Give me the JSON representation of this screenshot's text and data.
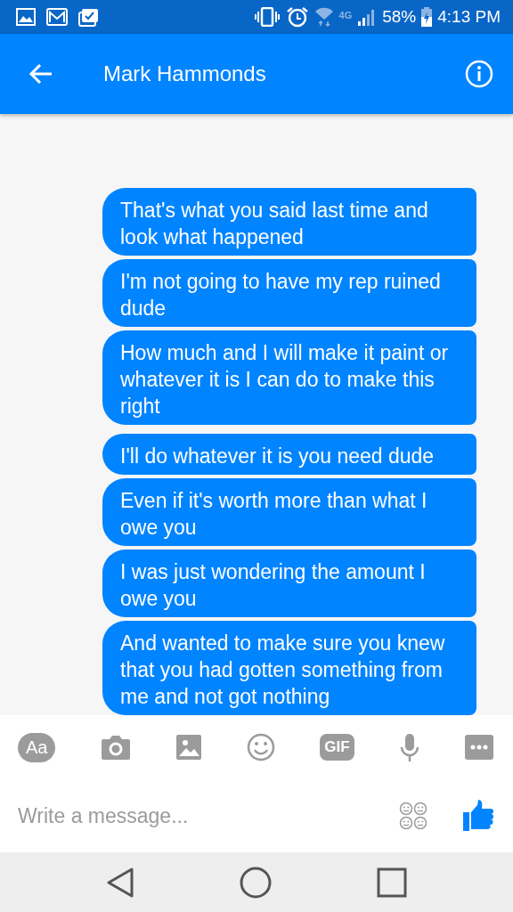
{
  "status_bar": {
    "network": "4G",
    "battery": "58%",
    "time": "4:13 PM"
  },
  "header": {
    "title": "Mark Hammonds"
  },
  "messages": [
    {
      "text": "That's what you said last time and look what happened"
    },
    {
      "text": "I'm not going to have my rep ruined dude"
    },
    {
      "text": "How much and I will make it paint or whatever it is I can do to make this right"
    },
    {
      "text": "I'll do whatever it is you need dude"
    },
    {
      "text": "Even if it's worth more than what I owe you"
    },
    {
      "text": "I was just wondering the amount I owe you"
    },
    {
      "text": "And wanted to make sure you knew that you had gotten something from me and not got nothing"
    }
  ],
  "toolbar": [
    {
      "kind": "text",
      "label": "Aa"
    },
    {
      "kind": "camera"
    },
    {
      "kind": "image"
    },
    {
      "kind": "smiley"
    },
    {
      "kind": "gif",
      "label": "GIF"
    },
    {
      "kind": "mic"
    },
    {
      "kind": "more"
    }
  ],
  "composer": {
    "placeholder": "Write a message..."
  }
}
